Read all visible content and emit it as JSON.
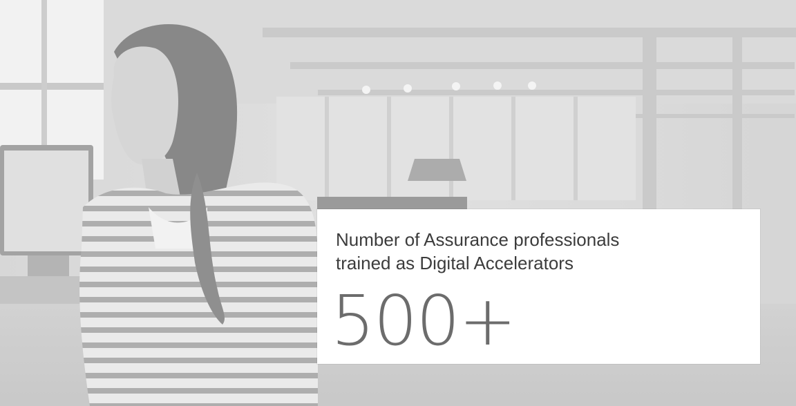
{
  "stat": {
    "label_line1": "Number of Assurance professionals",
    "label_line2": "trained as Digital Accelerators",
    "value": "500+"
  },
  "colors": {
    "background_tint": "#d8d8d8",
    "card": "#ffffff",
    "accent_bar": "#9a9a9a",
    "label_text": "#3c3c3c",
    "value_text": "#6c6c6c"
  }
}
